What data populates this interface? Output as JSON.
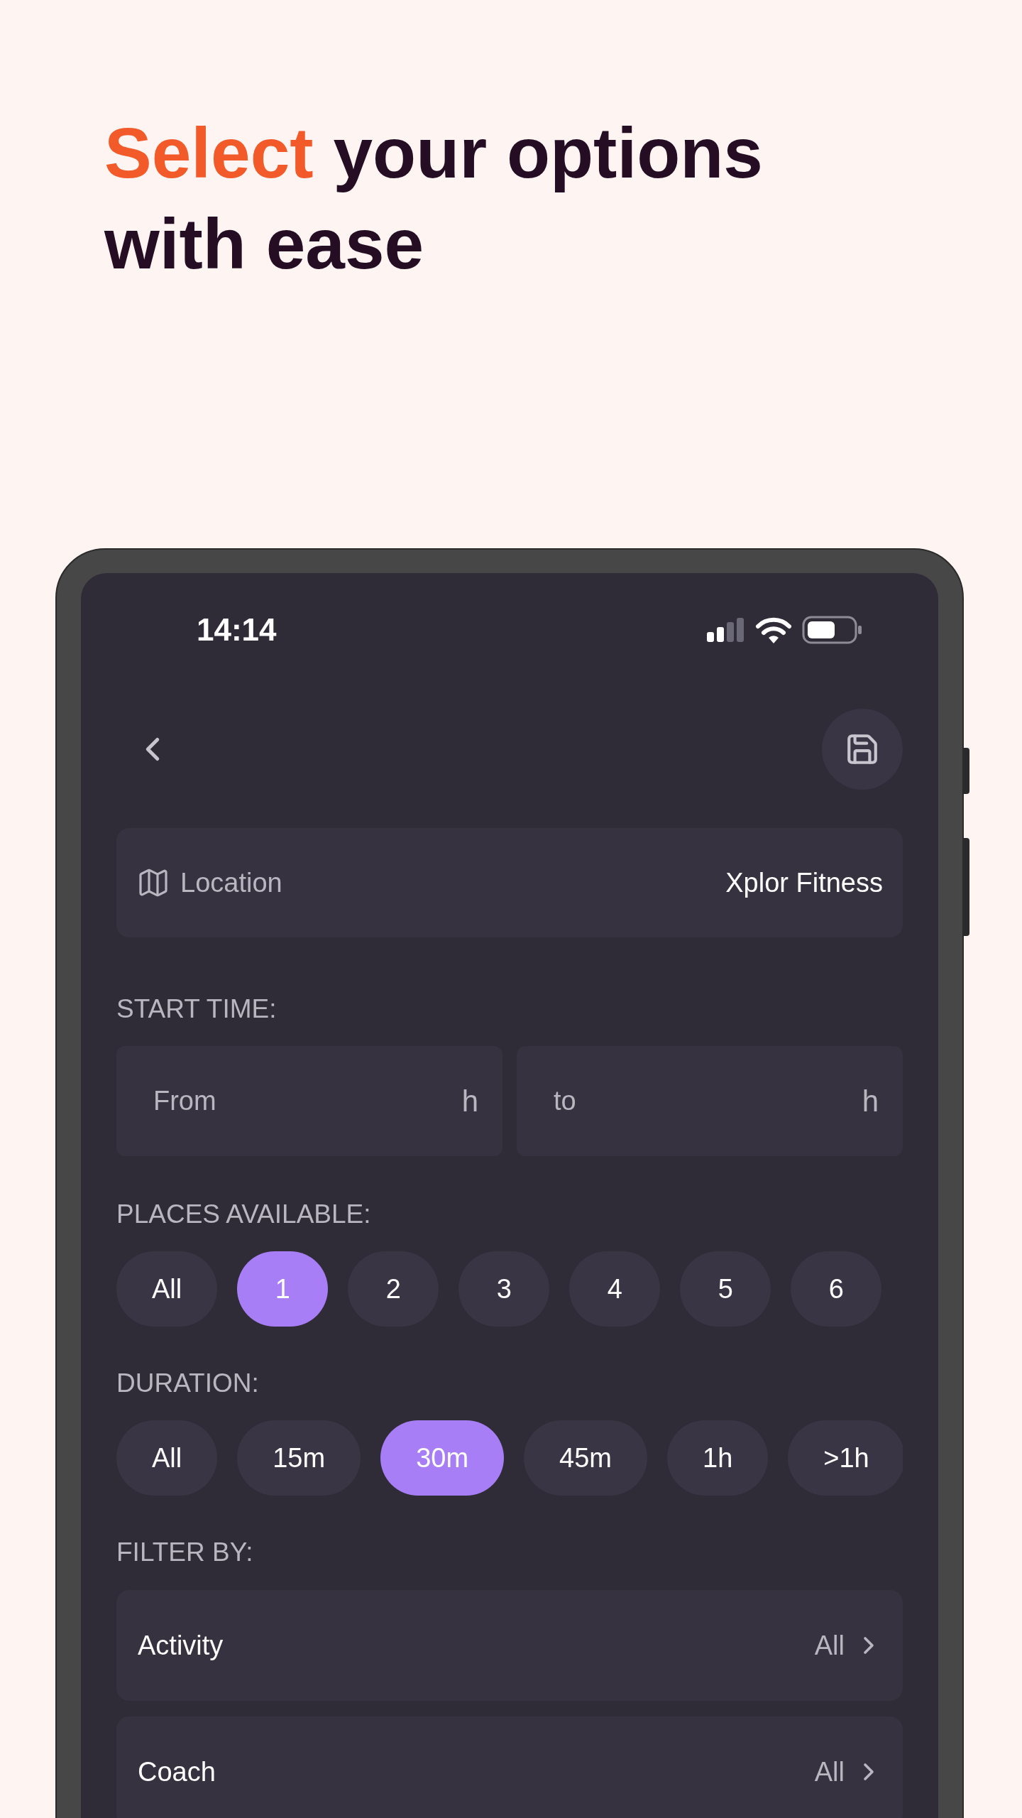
{
  "headline": {
    "highlight": "Select",
    "rest": "your options with ease"
  },
  "status_bar": {
    "time": "14:14"
  },
  "location": {
    "label": "Location",
    "value": "Xplor Fitness"
  },
  "start_time": {
    "label": "START TIME:",
    "from": {
      "placeholder": "From",
      "unit": "h"
    },
    "to": {
      "placeholder": "to",
      "unit": "h"
    }
  },
  "places_available": {
    "label": "PLACES AVAILABLE:",
    "options": [
      {
        "label": "All",
        "selected": false
      },
      {
        "label": "1",
        "selected": true
      },
      {
        "label": "2",
        "selected": false
      },
      {
        "label": "3",
        "selected": false
      },
      {
        "label": "4",
        "selected": false
      },
      {
        "label": "5",
        "selected": false
      },
      {
        "label": "6",
        "selected": false
      }
    ]
  },
  "duration": {
    "label": "DURATION:",
    "options": [
      {
        "label": "All",
        "selected": false
      },
      {
        "label": "15m",
        "selected": false
      },
      {
        "label": "30m",
        "selected": true
      },
      {
        "label": "45m",
        "selected": false
      },
      {
        "label": "1h",
        "selected": false
      },
      {
        "label": ">1h",
        "selected": false
      }
    ]
  },
  "filter_by": {
    "label": "FILTER BY:",
    "items": [
      {
        "label": "Activity",
        "value": "All"
      },
      {
        "label": "Coach",
        "value": "All"
      }
    ]
  }
}
